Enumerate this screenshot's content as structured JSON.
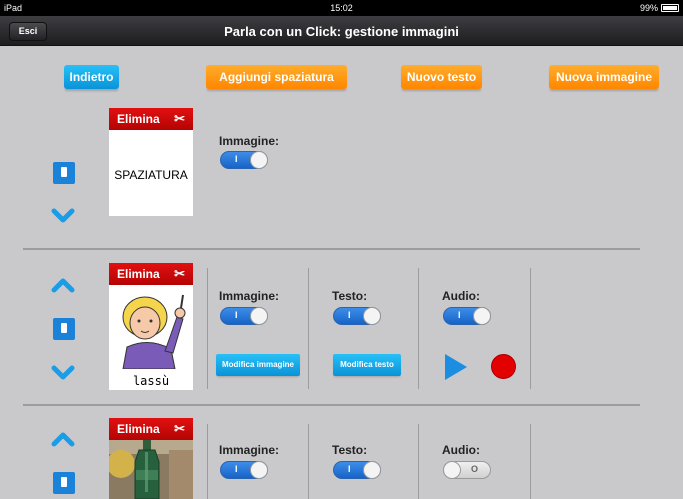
{
  "status_bar": {
    "device": "iPad",
    "time": "15:02",
    "battery": "99%"
  },
  "nav": {
    "title": "Parla con un Click: gestione immagini",
    "back_button": "Esci"
  },
  "top_buttons": {
    "back": "Indietro",
    "add_spacing": "Aggiungi spaziatura",
    "new_text": "Nuovo testo",
    "new_image": "Nuova immagine"
  },
  "rows": [
    {
      "delete_label": "Elimina",
      "card_text": "SPAZIATURA",
      "image_label": "Immagine:",
      "image_toggle": "on"
    },
    {
      "delete_label": "Elimina",
      "caption": "lassù",
      "image_label": "Immagine:",
      "image_toggle": "on",
      "text_label": "Testo:",
      "text_toggle": "on",
      "audio_label": "Audio:",
      "audio_toggle": "on",
      "edit_image": "Modifica immagine",
      "edit_text": "Modifica testo"
    },
    {
      "delete_label": "Elimina",
      "image_label": "Immagine:",
      "image_toggle": "on",
      "text_label": "Testo:",
      "text_toggle": "on",
      "audio_label": "Audio:",
      "audio_toggle": "off"
    }
  ],
  "toggle_glyphs": {
    "on": "I",
    "off": "O"
  },
  "colors": {
    "accent_blue": "#0a93d8",
    "accent_orange": "#ff8600",
    "delete_red": "#c80808",
    "record_red": "#e20000"
  }
}
